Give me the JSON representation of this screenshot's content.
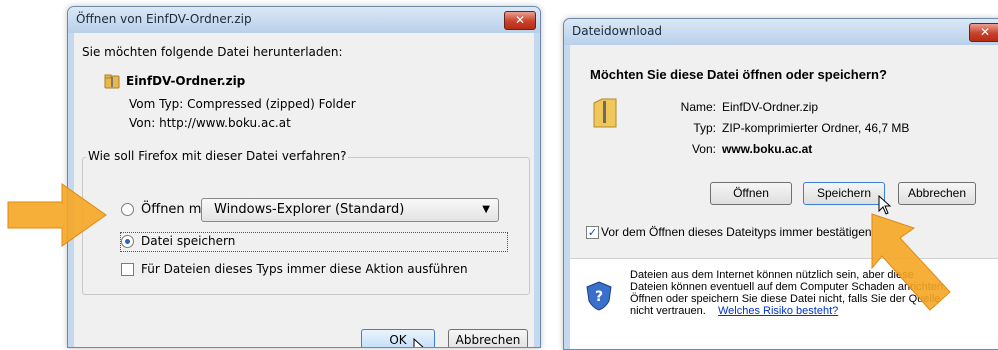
{
  "dialog1": {
    "title": "Öffnen von EinfDV-Ordner.zip",
    "close_glyph": "✕",
    "prompt": "Sie möchten folgende Datei herunterladen:",
    "file_name": "EinfDV-Ordner.zip",
    "type_line": "Vom Typ:  Compressed (zipped) Folder",
    "from_line": "Von:  http://www.boku.ac.at",
    "group_label": "Wie soll Firefox mit dieser Datei verfahren?",
    "open_with_label": "Öffnen mit",
    "open_with_value": "Windows-Explorer (Standard)",
    "save_label": "Datei speichern",
    "always_label": "Für Dateien dieses Typs immer diese Aktion ausführen",
    "ok_label": "OK",
    "cancel_label": "Abbrechen",
    "selected_option": "save",
    "always_checked": false
  },
  "dialog2": {
    "title": "Dateidownload",
    "close_glyph": "✕",
    "question": "Möchten Sie diese Datei öffnen oder speichern?",
    "name_key": "Name:",
    "name_val": "EinfDV-Ordner.zip",
    "type_key": "Typ:",
    "type_val": "ZIP-komprimierter Ordner, 46,7 MB",
    "from_key": "Von:",
    "from_val": "www.boku.ac.at",
    "open_label": "Öffnen",
    "save_label": "Speichern",
    "cancel_label": "Abbrechen",
    "confirm_label": "Vor dem Öffnen dieses Dateityps immer bestätigen",
    "confirm_checked": true,
    "warning_line1": "Dateien aus dem Internet können nützlich sein, aber diese",
    "warning_line2": "Dateien können eventuell auf dem Computer Schaden anrichten.",
    "warning_line3": "Öffnen oder speichern Sie diese Datei nicht, falls Sie der Quelle",
    "warning_line4": "nicht vertrauen.",
    "risk_link": "Welches Risiko besteht?"
  },
  "colors": {
    "arrow": "#f5a623",
    "link": "#0033cc",
    "accent": "#3c7fd6"
  },
  "icons": [
    "zip-folder-icon",
    "security-shield-icon",
    "mouse-cursor-icon",
    "highlight-arrow"
  ]
}
